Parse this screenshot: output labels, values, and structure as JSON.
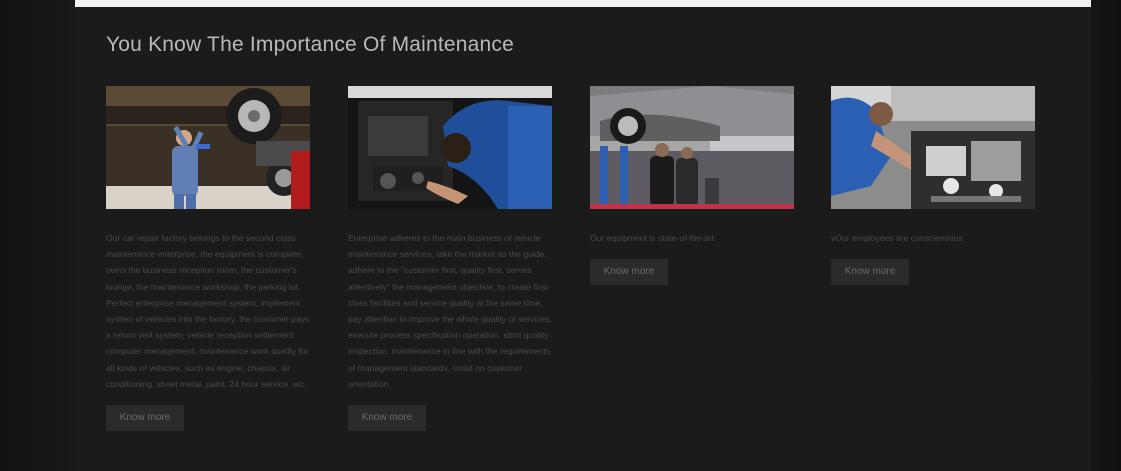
{
  "section": {
    "title": "You Know The Importance Of Maintenance"
  },
  "cards": [
    {
      "photo_icon": "mechanic-under-car-icon",
      "text": "Our car repair factory belongs to the second class maintenance enterprise, the equipment is complete, owns the business reception room, the customer's lounge, the maintenance workshop, the parking lot. Perfect enterprise management system, implement system of vehicles into the factory, the customer pays a return visit system, vehicle reception settlement computer management, maintenance work quality for all kinds of vehicles, such as engine, chassis, air conditioning, sheet metal, paint, 24 hour service, etc.",
      "button": "Know more"
    },
    {
      "photo_icon": "mechanic-engine-bay-icon",
      "text": "Enterprise adheres to the main business of vehicle maintenance services, take the market as the guide, adhere to the \"customer first, quality first, serves attentively\" the management objective, to create first-class facilities and service quality at the same time, pay attention to improve the whole quality of services, execute process specification operation, strict quality inspection, maintenance in line with the requirements of management standards. Insist on customer orientation.",
      "button": "Know more"
    },
    {
      "photo_icon": "car-on-lift-icon",
      "text": "Our equipment is state-of-the-art",
      "button": "Know more"
    },
    {
      "photo_icon": "mechanic-working-engine-icon",
      "text": "vOur employees are conscientious",
      "button": "Know more"
    }
  ]
}
